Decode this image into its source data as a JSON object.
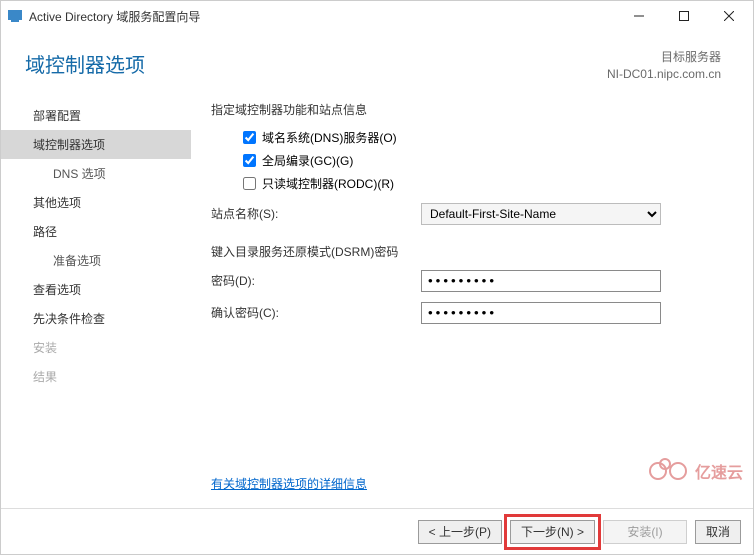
{
  "window": {
    "title": "Active Directory 域服务配置向导"
  },
  "header": {
    "page_title": "域控制器选项",
    "target_label": "目标服务器",
    "target_server": "NI-DC01.nipc.com.cn"
  },
  "sidebar": {
    "items": [
      {
        "label": "部署配置",
        "state": "normal"
      },
      {
        "label": "域控制器选项",
        "state": "active"
      },
      {
        "label": "DNS 选项",
        "state": "sub"
      },
      {
        "label": "其他选项",
        "state": "normal"
      },
      {
        "label": "路径",
        "state": "normal"
      },
      {
        "label": "准备选项",
        "state": "sub"
      },
      {
        "label": "查看选项",
        "state": "normal"
      },
      {
        "label": "先决条件检查",
        "state": "normal"
      },
      {
        "label": "安装",
        "state": "disabled"
      },
      {
        "label": "结果",
        "state": "disabled"
      }
    ]
  },
  "main": {
    "capabilities_label": "指定域控制器功能和站点信息",
    "chk_dns": {
      "label": "域名系统(DNS)服务器(O)",
      "checked": true
    },
    "chk_gc": {
      "label": "全局编录(GC)(G)",
      "checked": true
    },
    "chk_rodc": {
      "label": "只读域控制器(RODC)(R)",
      "checked": false
    },
    "site_label": "站点名称(S):",
    "site_value": "Default-First-Site-Name",
    "dsrm_label": "键入目录服务还原模式(DSRM)密码",
    "pwd_label": "密码(D):",
    "pwd_value": "•••••••••",
    "confirm_label": "确认密码(C):",
    "confirm_value": "•••••••••",
    "more_link": "有关域控制器选项的详细信息"
  },
  "footer": {
    "prev": "< 上一步(P)",
    "next": "下一步(N) >",
    "install": "安装(I)",
    "cancel": "取消"
  },
  "watermark": "亿速云"
}
